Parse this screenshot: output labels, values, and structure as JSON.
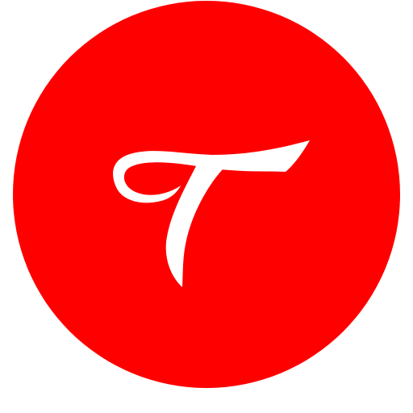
{
  "logo": {
    "lettering": "T",
    "icon": "script-letter-t-logo-icon",
    "colors": {
      "circle": "#ff0000",
      "letter": "#ffffff",
      "background": "#ffffff"
    }
  }
}
